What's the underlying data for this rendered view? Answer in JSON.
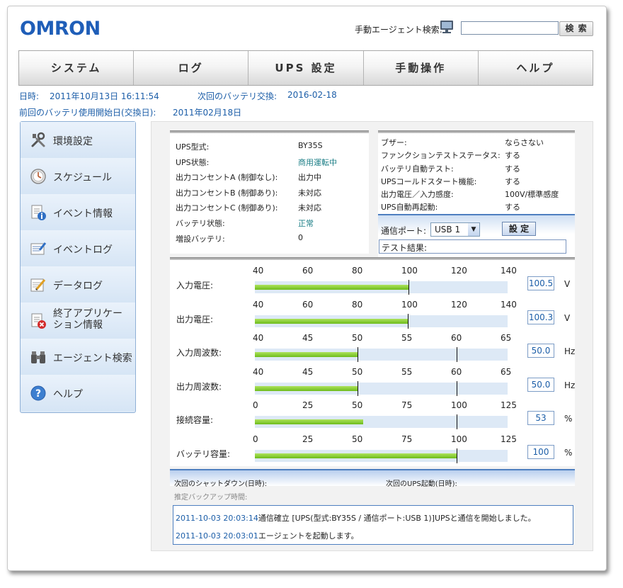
{
  "header": {
    "logo": "OMRON",
    "search_label": "手動エージェント検索:",
    "search_value": "",
    "search_button": "検 索"
  },
  "nav": {
    "items": [
      "システム",
      "ログ",
      "UPS 設定",
      "手動操作",
      "ヘルプ"
    ]
  },
  "info": {
    "datetime_label": "日時:",
    "datetime_value": "2011年10月13日 16:11:54",
    "next_battery_label": "次回のバッテリ交換:",
    "next_battery_value": "2016-02-18",
    "last_battery_label": "前回のバッテリ使用開始日(交換日):",
    "last_battery_value": "2011年02月18日"
  },
  "sidebar": {
    "items": [
      {
        "label": "環境設定",
        "icon": "tools-icon"
      },
      {
        "label": "スケジュール",
        "icon": "clock-icon"
      },
      {
        "label": "イベント情報",
        "icon": "event-info-icon"
      },
      {
        "label": "イベントログ",
        "icon": "event-log-icon"
      },
      {
        "label": "データログ",
        "icon": "data-log-icon"
      },
      {
        "label": "終了アプリケーション情報",
        "label_l1": "終了アプリケー",
        "label_l2": "ション情報",
        "icon": "shutdown-app-icon"
      },
      {
        "label": "エージェント検索",
        "icon": "binoculars-icon"
      },
      {
        "label": "ヘルプ",
        "icon": "help-icon"
      }
    ]
  },
  "status": {
    "rows": [
      {
        "label": "UPS型式:",
        "value": "BY35S"
      },
      {
        "label": "UPS状態:",
        "value": "商用運転中"
      },
      {
        "label": "出力コンセントA (制御なし):",
        "value": "出力中"
      },
      {
        "label": "出力コンセントB (制御あり):",
        "value": "未対応"
      },
      {
        "label": "出力コンセントC (制御あり):",
        "value": "未対応"
      },
      {
        "label": "バッテリ状態:",
        "value": "正常"
      },
      {
        "label": "増設バッテリ:",
        "value": "0"
      }
    ]
  },
  "settings": {
    "rows": [
      {
        "label": "ブザー:",
        "value": "ならさない"
      },
      {
        "label": "ファンクションテストステータス:",
        "value": "する"
      },
      {
        "label": "バッテリ自動テスト:",
        "value": "する"
      },
      {
        "label": "UPSコールドスタート機能:",
        "value": "する"
      },
      {
        "label": "出力電圧／入力感度:",
        "value": "100V/標準感度"
      },
      {
        "label": "UPS自動再起動:",
        "value": "する"
      }
    ],
    "port_label": "通信ポート:",
    "port_value": "USB 1",
    "set_button": "設 定",
    "test_result_label": "テスト結果:"
  },
  "meters": [
    {
      "label": "入力電圧:",
      "ticks": [
        "40",
        "60",
        "80",
        "100",
        "120",
        "140"
      ],
      "min": 40,
      "max": 140,
      "value": 100.5,
      "display": "100.5",
      "unit": "V",
      "marker": 100.5
    },
    {
      "label": "出力電圧:",
      "ticks": [
        "40",
        "60",
        "80",
        "100",
        "120",
        "140"
      ],
      "min": 40,
      "max": 140,
      "value": 100.3,
      "display": "100.3",
      "unit": "V",
      "marker": 100.3
    },
    {
      "label": "入力周波数:",
      "ticks": [
        "40",
        "45",
        "50",
        "55",
        "60",
        "65"
      ],
      "min": 40,
      "max": 65,
      "value": 50.0,
      "display": "50.0",
      "unit": "Hz",
      "marker": 50,
      "marker2": 60
    },
    {
      "label": "出力周波数:",
      "ticks": [
        "40",
        "45",
        "50",
        "55",
        "60",
        "65"
      ],
      "min": 40,
      "max": 65,
      "value": 50.0,
      "display": "50.0",
      "unit": "Hz",
      "marker": 50,
      "marker2": 60
    },
    {
      "label": "接続容量:",
      "ticks": [
        "0",
        "25",
        "50",
        "75",
        "100",
        "125"
      ],
      "min": 0,
      "max": 125,
      "value": 53,
      "display": "53",
      "unit": "%",
      "marker2": 100
    },
    {
      "label": "バッテリ容量:",
      "ticks": [
        "0",
        "25",
        "50",
        "75",
        "100",
        "125"
      ],
      "min": 0,
      "max": 125,
      "value": 100,
      "display": "100",
      "unit": "%",
      "marker": 100
    }
  ],
  "schedule": {
    "next_shutdown_label": "次回のシャットダウン(日時):",
    "next_startup_label": "次回のUPS起動(日時):",
    "backup_time_label": "推定バックアップ時間:"
  },
  "log": [
    {
      "timestamp": "2011-10-03 20:03:14",
      "message": "通信確立 [UPS(型式:BY35S / 通信ポート:USB 1)]UPSと通信を開始しました。"
    },
    {
      "timestamp": "2011-10-03 20:03:01",
      "message": "エージェントを起動します。"
    }
  ]
}
